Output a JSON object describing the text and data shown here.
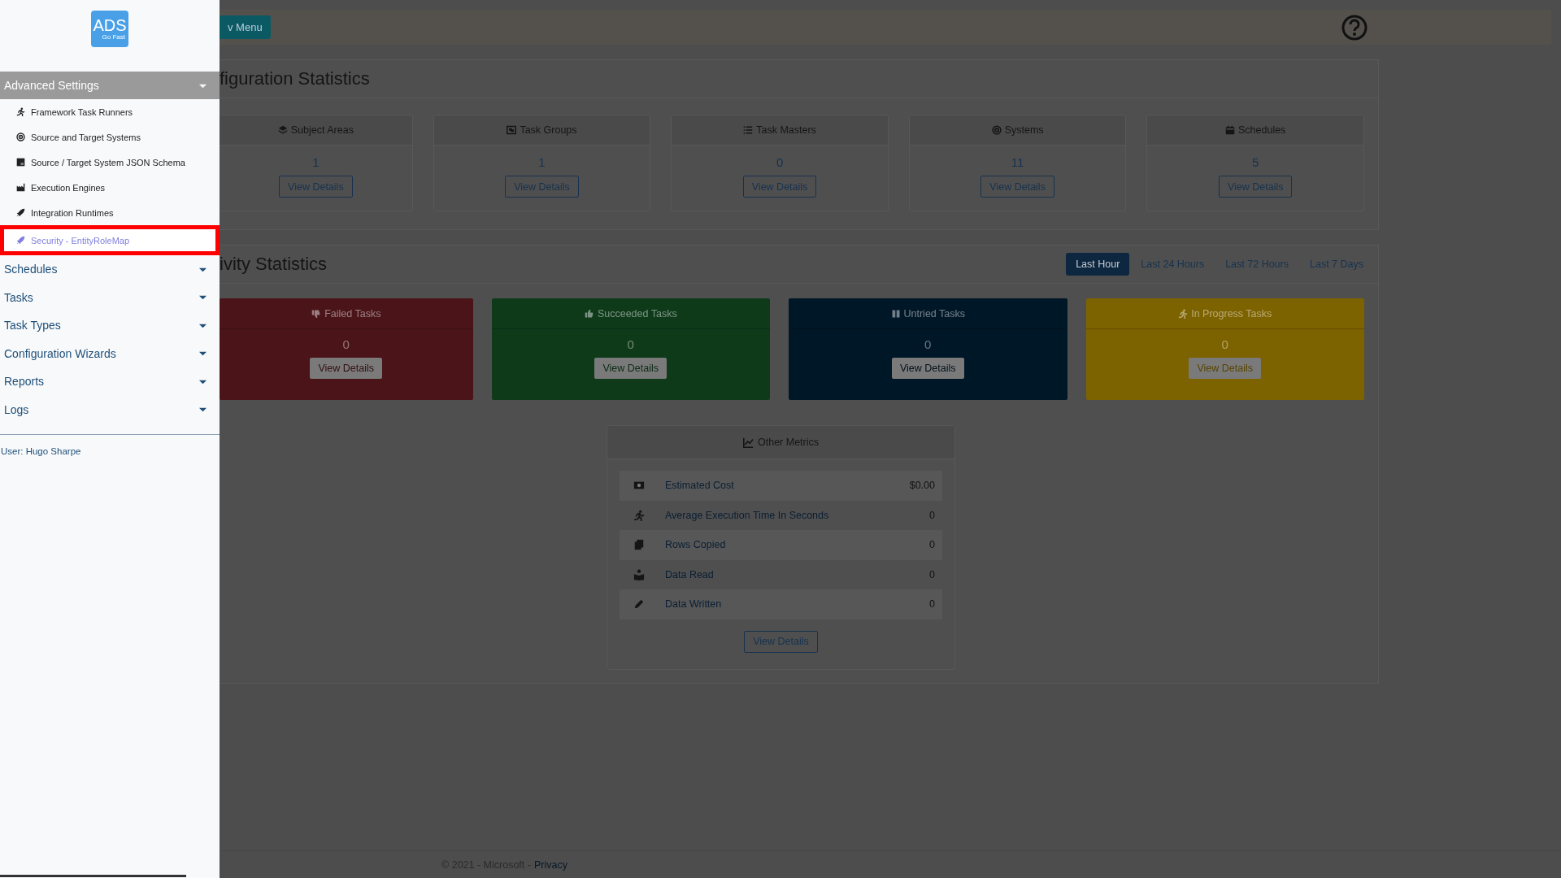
{
  "sidebar": {
    "logo": {
      "title": "ADS",
      "subtitle": "Go Fast"
    },
    "sections": [
      {
        "label": "Advanced Settings",
        "expanded": true,
        "items": [
          {
            "label": "Framework Task Runners",
            "selected": false
          },
          {
            "label": "Source and Target Systems",
            "selected": false
          },
          {
            "label": "Source / Target System JSON Schema",
            "selected": false
          },
          {
            "label": "Execution Engines",
            "selected": false
          },
          {
            "label": "Integration Runtimes",
            "selected": false
          },
          {
            "label": "Security - EntityRoleMap",
            "selected": true
          }
        ]
      },
      {
        "label": "Schedules",
        "expanded": false
      },
      {
        "label": "Tasks",
        "expanded": false
      },
      {
        "label": "Task Types",
        "expanded": false
      },
      {
        "label": "Configuration Wizards",
        "expanded": false
      },
      {
        "label": "Reports",
        "expanded": false
      },
      {
        "label": "Logs",
        "expanded": false
      }
    ],
    "user": "User: Hugo Sharpe"
  },
  "top_bar": {
    "menu_button": "v Menu"
  },
  "configuration_statistics": {
    "title": "figuration Statistics",
    "cards": [
      {
        "label": "Subject Areas",
        "count": "1",
        "button": "View Details"
      },
      {
        "label": "Task Groups",
        "count": "1",
        "button": "View Details"
      },
      {
        "label": "Task Masters",
        "count": "0",
        "button": "View Details"
      },
      {
        "label": "Systems",
        "count": "11",
        "button": "View Details"
      },
      {
        "label": "Schedules",
        "count": "5",
        "button": "View Details"
      }
    ]
  },
  "activity_statistics": {
    "title": "ivity Statistics",
    "ranges": [
      {
        "label": "Last Hour",
        "selected": true
      },
      {
        "label": "Last 24 Hours",
        "selected": false
      },
      {
        "label": "Last 72 Hours",
        "selected": false
      },
      {
        "label": "Last 7 Days",
        "selected": false
      }
    ],
    "cards": [
      {
        "label": "Failed Tasks",
        "count": "0",
        "button": "View Details",
        "color": "#4a1419"
      },
      {
        "label": "Succeeded Tasks",
        "count": "0",
        "button": "View Details",
        "color": "#0e3a1a"
      },
      {
        "label": "Untried Tasks",
        "count": "0",
        "button": "View Details",
        "color": "#001727"
      },
      {
        "label": "In Progress Tasks",
        "count": "0",
        "button": "View Details",
        "color": "#7d6200"
      }
    ]
  },
  "other_metrics": {
    "title": "Other Metrics",
    "rows": [
      {
        "label": "Estimated Cost",
        "value": "$0.00"
      },
      {
        "label": "Average Execution Time In Seconds",
        "value": "0"
      },
      {
        "label": "Rows Copied",
        "value": "0"
      },
      {
        "label": "Data Read",
        "value": "0"
      },
      {
        "label": "Data Written",
        "value": "0"
      }
    ],
    "button": "View Details"
  },
  "footer": {
    "text": "© 2021 - Microsoft -",
    "link": "Privacy"
  }
}
